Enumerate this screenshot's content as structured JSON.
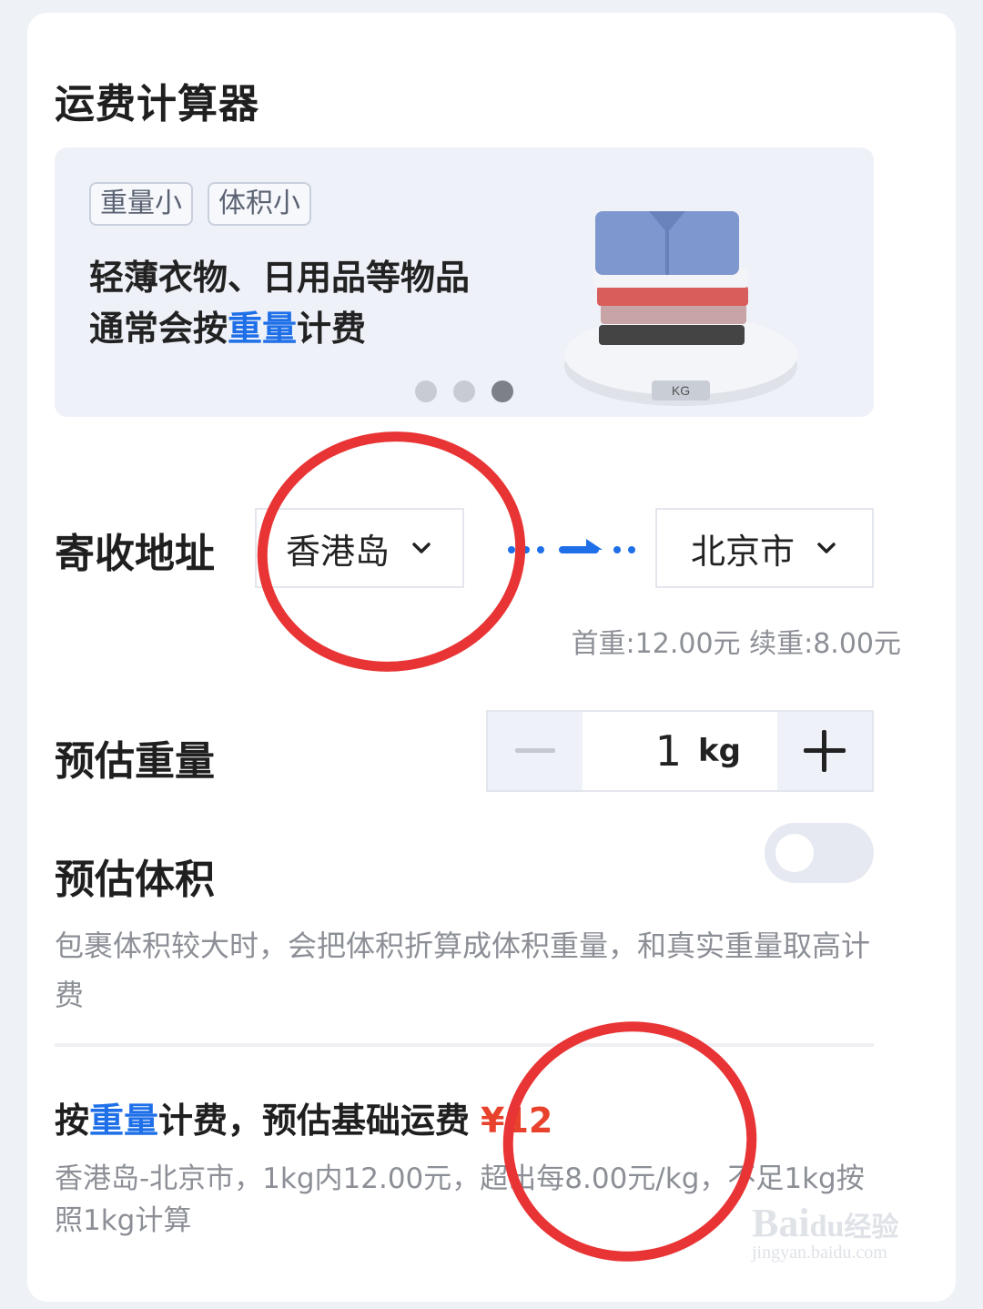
{
  "page": {
    "title": "运费计算器"
  },
  "banner": {
    "tags": [
      "重量小",
      "体积小"
    ],
    "line1": "轻薄衣物、日用品等物品",
    "line2_pre": "通常会按",
    "line2_hl": "重量",
    "line2_post": "计费",
    "scale_label": "KG",
    "carousel_total": 3,
    "carousel_active_index": 2
  },
  "address": {
    "label": "寄收地址",
    "from": "香港岛",
    "to": "北京市",
    "rate_note": "首重:12.00元 续重:8.00元"
  },
  "weight": {
    "label": "预估重量",
    "value": "1",
    "unit": "kg"
  },
  "volume": {
    "label": "预估体积",
    "toggle_on": false,
    "description": "包裹体积较大时，会把体积折算成体积重量，和真实重量取高计费"
  },
  "result": {
    "pre": "按",
    "hl": "重量",
    "post": "计费，预估基础运费",
    "price": "¥12",
    "detail": "香港岛-北京市，1kg内12.00元，超出每8.00元/kg，不足1kg按照1kg计算"
  },
  "watermark": {
    "brand": "Baidu经验",
    "url": "jingyan.baidu.com"
  },
  "colors": {
    "accent": "#1e6fe8",
    "price": "#e8412c",
    "annotation": "#e83434"
  }
}
